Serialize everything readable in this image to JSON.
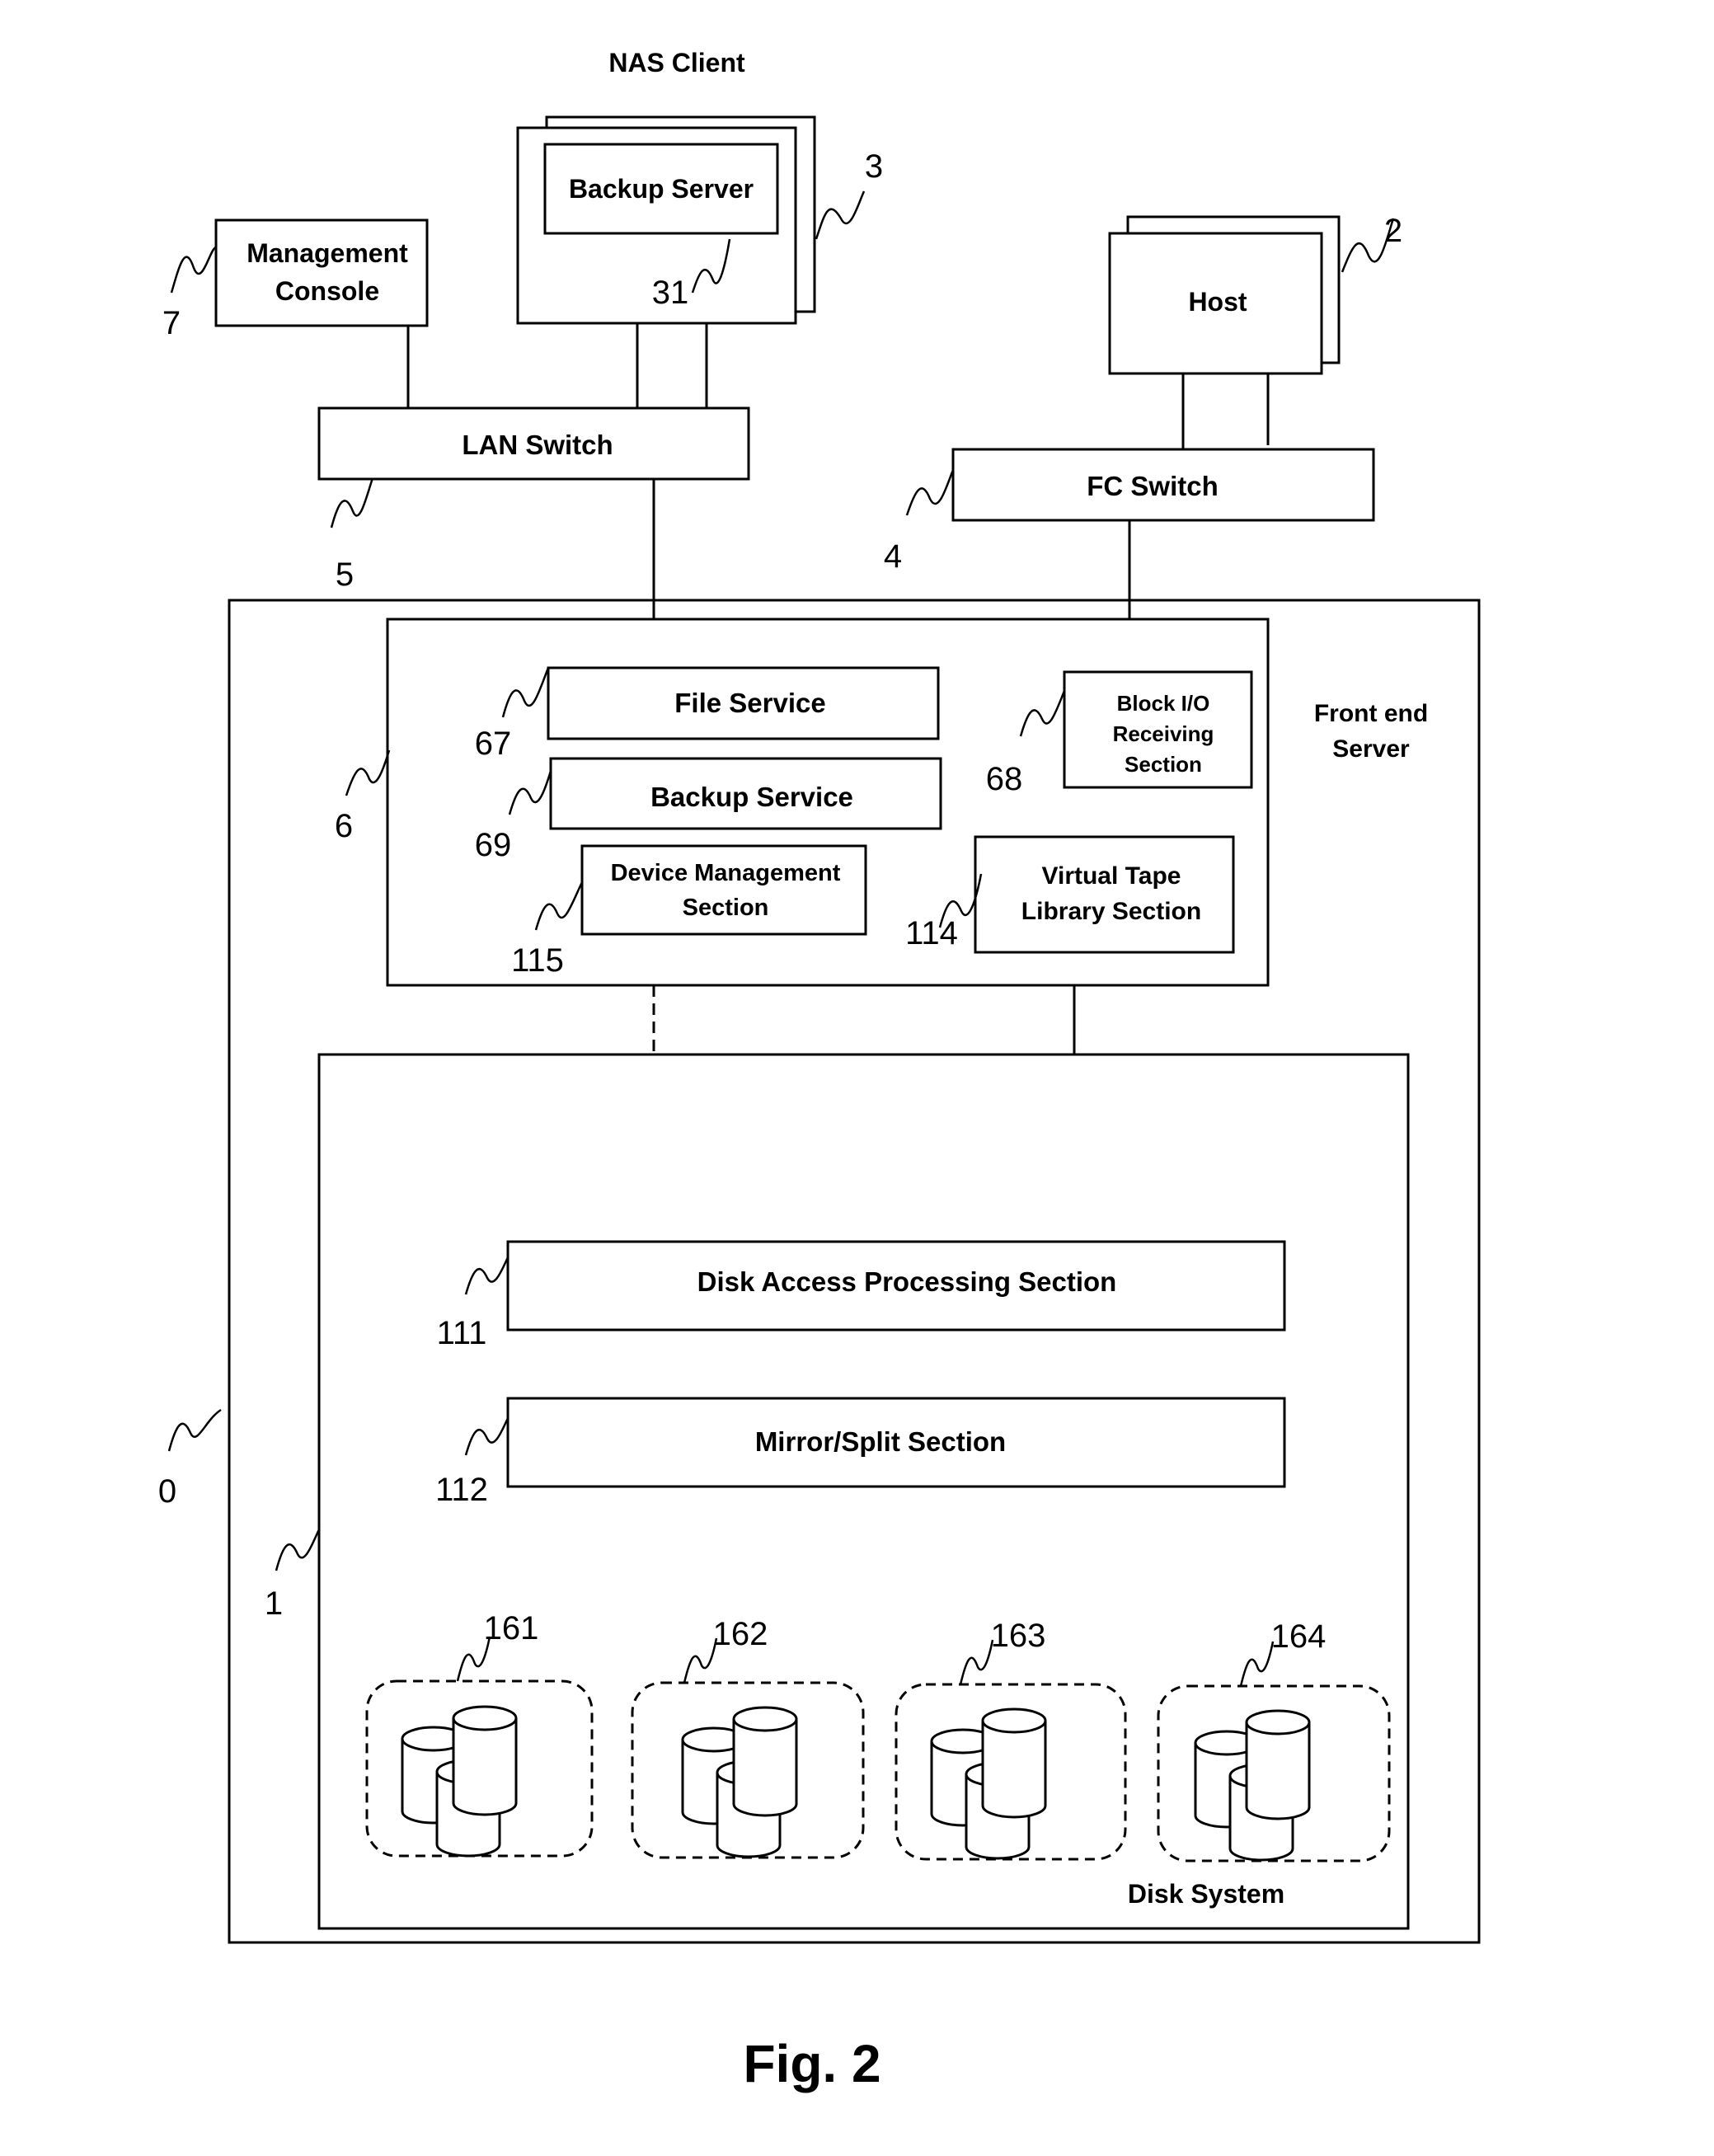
{
  "figure": {
    "caption": "Fig. 2",
    "nas_client_label": "NAS Client",
    "management_console": {
      "line1": "Management",
      "line2": "Console",
      "ref": "7"
    },
    "backup_server": {
      "label": "Backup Server",
      "ref": "31",
      "client_ref": "3"
    },
    "host": {
      "label": "Host",
      "ref": "2"
    },
    "lan_switch": {
      "label": "LAN Switch",
      "ref": "5"
    },
    "fc_switch": {
      "label": "FC Switch",
      "ref": "4"
    },
    "system": {
      "ref": "0"
    },
    "front_end_server": {
      "line1": "Front end",
      "line2": "Server",
      "ref": "6",
      "file_service": {
        "label": "File Service",
        "ref": "67"
      },
      "backup_service": {
        "label": "Backup Service",
        "ref": "69"
      },
      "device_management": {
        "line1": "Device Management",
        "line2": "Section",
        "ref": "115"
      },
      "block_io": {
        "line1": "Block I/O",
        "line2": "Receiving",
        "line3": "Section",
        "ref": "68"
      },
      "virtual_tape": {
        "line1": "Virtual Tape",
        "line2": "Library Section",
        "ref": "114"
      }
    },
    "disk_system": {
      "label": "Disk System",
      "ref": "1",
      "disk_access": {
        "label": "Disk Access Processing Section",
        "ref": "111"
      },
      "mirror_split": {
        "label": "Mirror/Split Section",
        "ref": "112"
      },
      "disk_groups": [
        {
          "ref": "161"
        },
        {
          "ref": "162"
        },
        {
          "ref": "163"
        },
        {
          "ref": "164"
        }
      ]
    }
  }
}
